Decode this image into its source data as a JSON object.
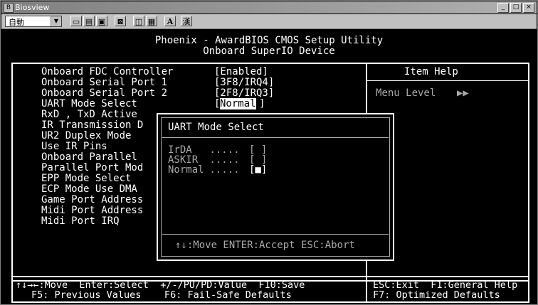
{
  "window": {
    "title": "Biosview",
    "icon": "bios-icon",
    "buttons": [
      "_",
      "□",
      "×"
    ]
  },
  "toolbar": {
    "combo_value": "自動",
    "buttons": [
      "copy-icon",
      "paste-icon",
      "clipboard-icon",
      "fullscreen-icon",
      "settings-icon",
      "window-icon",
      "font-icon",
      "kanji-icon"
    ],
    "font_glyph": "A",
    "kanji_glyph": "漢"
  },
  "screen": {
    "title_line1": "Phoenix - AwardBIOS CMOS Setup Utility",
    "title_line2": "Onboard SuperIO Device",
    "items": [
      {
        "label": "Onboard FDC Controller",
        "value": "[Enabled]"
      },
      {
        "label": "Onboard Serial Port 1",
        "value": "[3F8/IRQ4]"
      },
      {
        "label": "Onboard Serial Port 2",
        "value": "[2F8/IRQ3]"
      },
      {
        "label": "UART Mode Select",
        "value": "Normal"
      },
      {
        "label": "RxD , TxD Active",
        "value": ""
      },
      {
        "label": "IR Transmission D",
        "value": ""
      },
      {
        "label": "UR2 Duplex Mode",
        "value": ""
      },
      {
        "label": "Use IR Pins",
        "value": ""
      },
      {
        "label": "Onboard Parallel",
        "value": ""
      },
      {
        "label": "Parallel Port Mod",
        "value": ""
      },
      {
        "label": "EPP Mode Select",
        "value": ""
      },
      {
        "label": "ECP Mode Use DMA",
        "value": ""
      },
      {
        "label": "Game Port Address",
        "value": ""
      },
      {
        "label": "Midi Port Address",
        "value": ""
      },
      {
        "label": "Midi Port IRQ",
        "value": ""
      }
    ],
    "uart_bracket_open": "[",
    "uart_bracket_close": "]",
    "help": {
      "title": "Item Help",
      "menu_level": "Menu Level",
      "arrows": "▶▶"
    },
    "dialog": {
      "title": "UART Mode Select",
      "options": [
        {
          "label": "IrDA",
          "dots": " ..... ",
          "mark": "[ ]",
          "selected": false
        },
        {
          "label": "ASKIR",
          "dots": " ..... ",
          "mark": "[ ]",
          "selected": false
        },
        {
          "label": "Normal",
          "dots": " ..... ",
          "mark": "[■]",
          "selected": true
        }
      ],
      "footer": "↑↓:Move ENTER:Accept ESC:Abort"
    },
    "bottom_line1_left": "↑↓→←:Move  Enter:Select  +/-/PU/PD:Value  F10:Save",
    "bottom_line1_right": "ESC:Exit  F1:General Help",
    "bottom_line2_left": "F5: Previous Values    F6: Fail-Safe Defaults",
    "bottom_line2_right": "F7: Optimized Defaults"
  }
}
